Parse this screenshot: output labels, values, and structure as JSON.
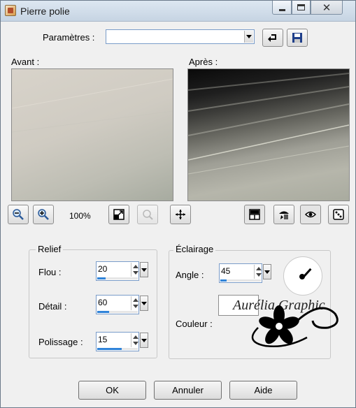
{
  "window": {
    "title": "Pierre polie",
    "controls": [
      "minimize-icon",
      "maximize-icon",
      "close-icon"
    ],
    "close_glyph": "✕"
  },
  "presets": {
    "label": "Paramètres :",
    "value": ""
  },
  "preview": {
    "before_label": "Avant :",
    "after_label": "Après :",
    "zoom": "100%"
  },
  "relief": {
    "title": "Relief",
    "fields": [
      {
        "label": "Flou :",
        "value": "20",
        "level": 0.2
      },
      {
        "label": "Détail :",
        "value": "60",
        "level": 0.3
      },
      {
        "label": "Polissage :",
        "value": "15",
        "level": 0.6
      }
    ]
  },
  "lighting": {
    "title": "Éclairage",
    "angle_label": "Angle :",
    "angle_value": "45",
    "angle_level": 0.15,
    "color_label": "Couleur :"
  },
  "buttons": {
    "ok": "OK",
    "cancel": "Annuler",
    "help": "Aide"
  },
  "watermark": "Aurélia Graphic"
}
